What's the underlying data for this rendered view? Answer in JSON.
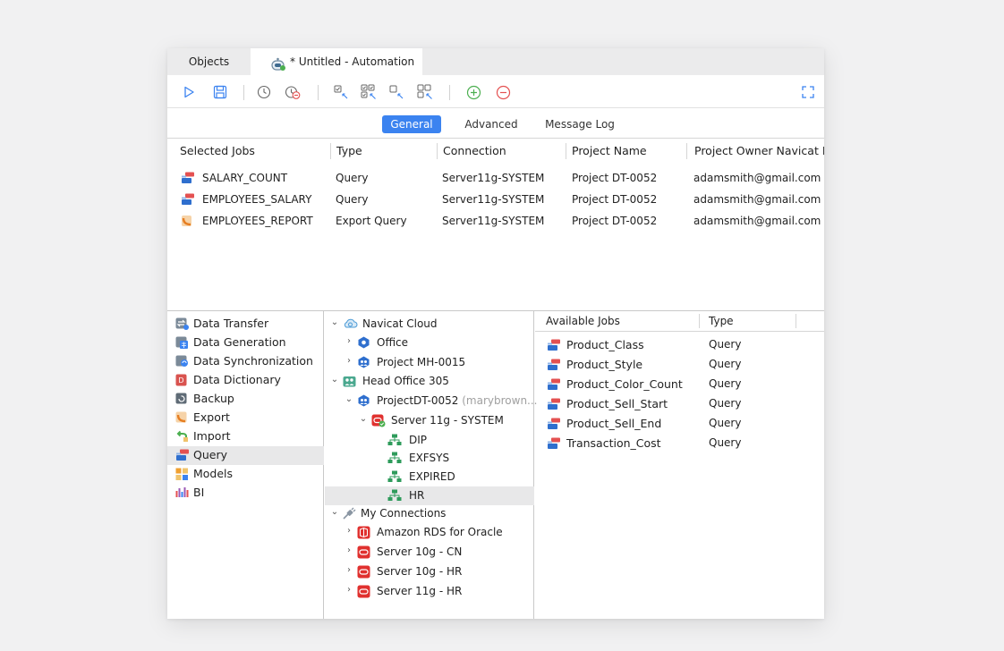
{
  "tabs": {
    "objects": "Objects",
    "active": "* Untitled - Automation"
  },
  "subtabs": [
    "General",
    "Advanced",
    "Message Log"
  ],
  "columns": [
    "Selected Jobs",
    "Type",
    "Connection",
    "Project Name",
    "Project Owner Navicat ID"
  ],
  "selected_jobs": [
    {
      "name": "SALARY_COUNT",
      "type": "Query",
      "connection": "Server11g-SYSTEM",
      "project": "Project DT-0052",
      "owner": "adamsmith@gmail.com"
    },
    {
      "name": "EMPLOYEES_SALARY",
      "type": "Query",
      "connection": "Server11g-SYSTEM",
      "project": "Project DT-0052",
      "owner": "adamsmith@gmail.com"
    },
    {
      "name": "EMPLOYEES_REPORT",
      "type": "Export Query",
      "connection": "Server11g-SYSTEM",
      "project": "Project DT-0052",
      "owner": "adamsmith@gmail.com"
    }
  ],
  "categories": [
    "Data Transfer",
    "Data Generation",
    "Data Synchronization",
    "Data Dictionary",
    "Backup",
    "Export",
    "Import",
    "Query",
    "Models",
    "BI"
  ],
  "selected_category": "Query",
  "tree": {
    "navicat_cloud": "Navicat Cloud",
    "office": "Office",
    "project_mh": "Project MH-0015",
    "head_office": "Head Office 305",
    "project_dt": "ProjectDT-0052",
    "project_dt_owner": "(marybrown...",
    "server11g_system": "Server 11g - SYSTEM",
    "schemas": [
      "DIP",
      "EXFSYS",
      "EXPIRED",
      "HR"
    ],
    "my_connections": "My Connections",
    "amazon_rds": "Amazon RDS for Oracle",
    "server10g_cn": "Server 10g - CN",
    "server10g_hr": "Server 10g - HR",
    "server11g_hr": "Server 11g - HR"
  },
  "available_jobs": {
    "header_name": "Available Jobs",
    "header_type": "Type",
    "items": [
      {
        "name": "Product_Class",
        "type": "Query"
      },
      {
        "name": "Product_Style",
        "type": "Query"
      },
      {
        "name": "Product_Color_Count",
        "type": "Query"
      },
      {
        "name": "Product_Sell_Start",
        "type": "Query"
      },
      {
        "name": "Product_Sell_End",
        "type": "Query"
      },
      {
        "name": "Transaction_Cost",
        "type": "Query"
      }
    ]
  },
  "colors": {
    "accent": "#3b83f0",
    "run": "#3b83f0",
    "add": "#4caf50",
    "remove": "#e45151",
    "oracle": "#e0312f"
  }
}
